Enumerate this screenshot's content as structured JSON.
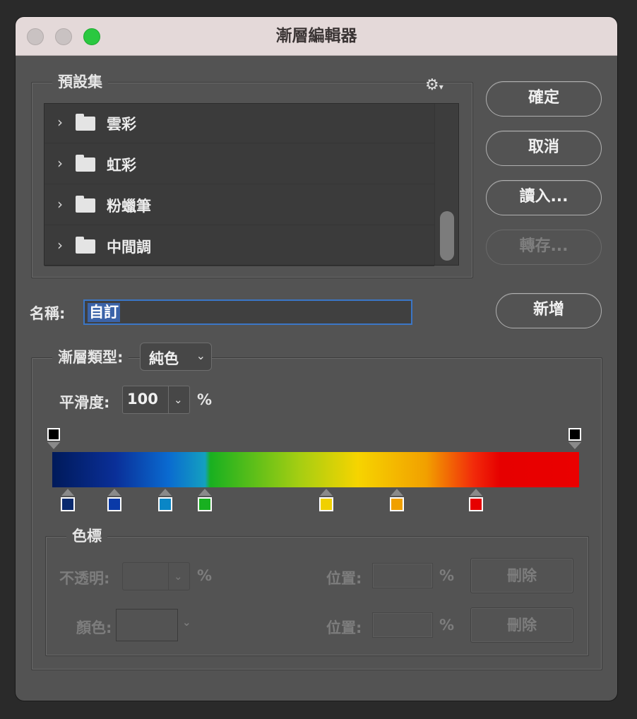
{
  "window": {
    "title": "漸層編輯器"
  },
  "presets": {
    "legend": "預設集",
    "items": [
      {
        "label": "雲彩"
      },
      {
        "label": "虹彩"
      },
      {
        "label": "粉蠟筆"
      },
      {
        "label": "中間調"
      }
    ]
  },
  "buttons": {
    "ok": "確定",
    "cancel": "取消",
    "load": "讀入...",
    "save": "轉存...",
    "new": "新增"
  },
  "name": {
    "label": "名稱:",
    "value": "自訂"
  },
  "gradient_type": {
    "label": "漸層類型:",
    "value": "純色"
  },
  "smoothness": {
    "label": "平滑度:",
    "value": "100",
    "unit": "%"
  },
  "stops_group": {
    "legend": "色標",
    "opacity_label": "不透明:",
    "opacity_unit": "%",
    "color_label": "顏色:",
    "location_label_1": "位置:",
    "location_unit_1": "%",
    "location_label_2": "位置:",
    "location_unit_2": "%",
    "delete_1": "刪除",
    "delete_2": "刪除"
  },
  "gradient_colors": {
    "opacity_stop": "#000000",
    "color_stops": [
      "#0a2a6e",
      "#0a3aa8",
      "#0a86c6",
      "#18b020",
      "#f0d000",
      "#f0a000",
      "#e60000"
    ]
  }
}
